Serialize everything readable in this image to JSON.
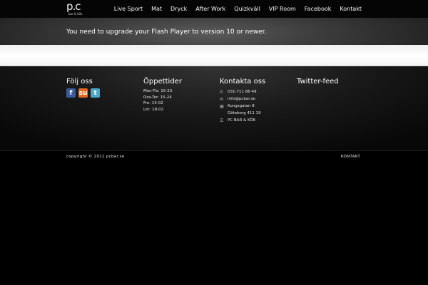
{
  "logo": {
    "main": "p.c",
    "sub": "bar & kök"
  },
  "nav": [
    {
      "label": "Live Sport"
    },
    {
      "label": "Mat"
    },
    {
      "label": "Dryck"
    },
    {
      "label": "After Work"
    },
    {
      "label": "Quizkväll"
    },
    {
      "label": "VIP Room"
    },
    {
      "label": "Facebook"
    },
    {
      "label": "Kontakt"
    }
  ],
  "flash": {
    "message": "You need to upgrade your Flash Player to version 10 or newer."
  },
  "footer": {
    "follow": {
      "heading": "Följ oss",
      "icons": [
        {
          "glyph": "f",
          "icon": "facebook-icon",
          "color": "#3b5a9a"
        },
        {
          "glyph": "su",
          "icon": "stumbleupon-icon",
          "color": "#e06a22"
        },
        {
          "glyph": "t",
          "icon": "twitter-icon",
          "color": "#4aa9c8"
        }
      ]
    },
    "hours": {
      "heading": "Öppettider",
      "lines": [
        "Mon-Tis: 15-23",
        "Ons-Tor: 15-24",
        "Fre: 15-02",
        "Lör: 18-02"
      ]
    },
    "contact": {
      "heading": "Kontakta oss",
      "phone": "031-711 88 49",
      "email": "info@pcbar.se",
      "street": "Kungsgatan 8",
      "city": "Göteborg 411 19",
      "name": "PC BAR & KÖK"
    },
    "twitter": {
      "heading": "Twitter-feed"
    }
  },
  "bottom": {
    "copyright": "copyright © 2011 pcbar.se",
    "link": "KONTAKT"
  }
}
